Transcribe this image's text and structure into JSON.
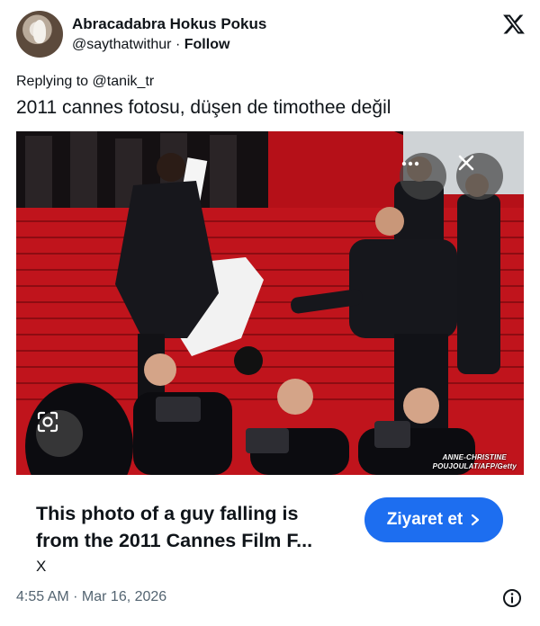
{
  "author": {
    "display_name": "Abracadabra Hokus Pokus",
    "handle": "@saythatwithur",
    "separator": "·",
    "follow_label": "Follow"
  },
  "reply": {
    "prefix": "Replying to ",
    "target": "@tanik_tr"
  },
  "tweet_text": "2011 cannes fotosu, düşen de timothee değil",
  "media": {
    "credit_line1": "ANNE-CHRISTINE",
    "credit_line2": "POUJOULAT/AFP/Getty",
    "more_icon": "more-horizontal-icon",
    "close_icon": "close-icon",
    "lens_icon": "visual-search-icon"
  },
  "ad_card": {
    "title_line1": "This photo of a guy falling is",
    "title_line2": "from the 2011 Cannes Film F...",
    "source": "X",
    "cta_label": "Ziyaret et",
    "cta_color": "#1d6ef0"
  },
  "footer": {
    "timestamp": "4:55 AM · Mar 16, 2026",
    "info_icon": "info-icon"
  },
  "colors": {
    "text": "#0f1419",
    "muted": "#536471",
    "carpet": "#c0141c"
  }
}
